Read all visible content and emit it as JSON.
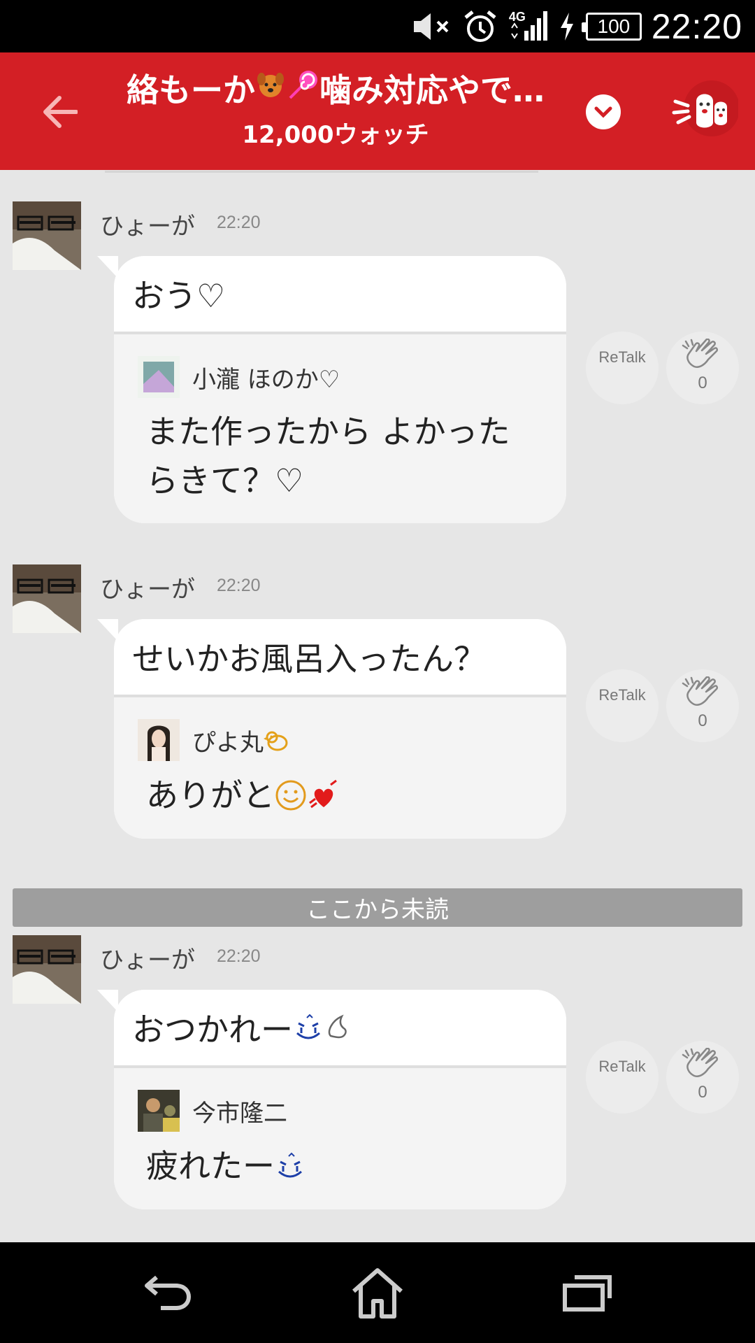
{
  "status_bar": {
    "time": "22:20",
    "network": "4G",
    "battery": "100",
    "icons": [
      "mute-icon",
      "alarm-icon",
      "signal-icon",
      "charging-icon",
      "battery-icon"
    ]
  },
  "header": {
    "title_part1": "絡もーか",
    "title_part2": "噛み対応やで…",
    "title_emojis": [
      "dog-face-icon",
      "lollipop-icon"
    ],
    "subtitle": "12,000ウォッチ",
    "accent_color": "#d31f25"
  },
  "messages": [
    {
      "sender": "ひょーが",
      "time": "22:20",
      "text": "おう♡",
      "quote": {
        "name": "小瀧 ほのか♡",
        "text_line1": "また作ったから よかった",
        "text_line2": "らきて？♡"
      },
      "retalk_label": "ReTalk",
      "clap_count": "0"
    },
    {
      "sender": "ひょーが",
      "time": "22:20",
      "text": "せいかお風呂入ったん？",
      "quote": {
        "name": "ぴよ丸",
        "text": "ありがと"
      },
      "retalk_label": "ReTalk",
      "clap_count": "0"
    },
    {
      "sender": "ひょーが",
      "time": "22:20",
      "text": "おつかれー",
      "quote": {
        "name": "今市隆二",
        "text": "疲れたー"
      },
      "retalk_label": "ReTalk",
      "clap_count": "0"
    }
  ],
  "unread_divider": "ここから未読",
  "nav": {
    "icons": [
      "back-nav-icon",
      "home-nav-icon",
      "recents-nav-icon"
    ]
  }
}
